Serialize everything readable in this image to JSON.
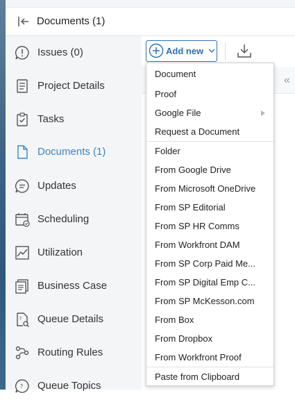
{
  "header": {
    "title": "Documents (1)"
  },
  "nav": {
    "items": [
      {
        "label": "Issues (0)",
        "icon": "issues-icon"
      },
      {
        "label": "Project Details",
        "icon": "project-details-icon"
      },
      {
        "label": "Tasks",
        "icon": "tasks-icon"
      },
      {
        "label": "Documents (1)",
        "icon": "documents-icon",
        "active": true
      },
      {
        "label": "Updates",
        "icon": "updates-icon"
      },
      {
        "label": "Scheduling",
        "icon": "scheduling-icon"
      },
      {
        "label": "Utilization",
        "icon": "utilization-icon"
      },
      {
        "label": "Business Case",
        "icon": "business-case-icon"
      },
      {
        "label": "Queue Details",
        "icon": "queue-details-icon"
      },
      {
        "label": "Routing Rules",
        "icon": "routing-rules-icon"
      },
      {
        "label": "Queue Topics",
        "icon": "queue-topics-icon"
      }
    ]
  },
  "toolbar": {
    "add_new_label": "Add new"
  },
  "dropdown": {
    "items": [
      "Document",
      "Proof",
      "Google File",
      "Request a Document",
      "Folder",
      "From Google Drive",
      "From Microsoft OneDrive",
      "From SP Editorial",
      "From SP HR Comms",
      "From Workfront DAM",
      "From SP Corp Paid Me...",
      "From SP Digital Emp C...",
      "From SP McKesson.com",
      "From Box",
      "From Dropbox",
      "From Workfront Proof",
      "Paste from Clipboard"
    ]
  },
  "colors": {
    "accent": "#2f6fb4",
    "active_nav": "#3b86c6"
  }
}
